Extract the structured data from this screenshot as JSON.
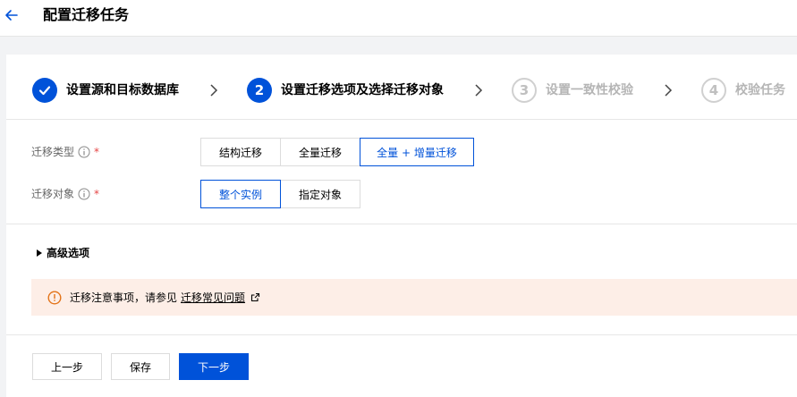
{
  "header": {
    "title": "配置迁移任务",
    "back_icon": "arrow-left-icon"
  },
  "steps": [
    {
      "number": "",
      "label": "设置源和目标数据库",
      "status": "done"
    },
    {
      "number": "2",
      "label": "设置迁移选项及选择迁移对象",
      "status": "active"
    },
    {
      "number": "3",
      "label": "设置一致性校验",
      "status": "wait"
    },
    {
      "number": "4",
      "label": "校验任务",
      "status": "wait"
    }
  ],
  "form": {
    "migration_type": {
      "label": "迁移类型",
      "options": [
        "结构迁移",
        "全量迁移",
        "全量 + 增量迁移"
      ],
      "selected": "全量 + 增量迁移"
    },
    "migration_object": {
      "label": "迁移对象",
      "options": [
        "整个实例",
        "指定对象"
      ],
      "selected": "整个实例"
    },
    "required_mark": "*"
  },
  "advanced": {
    "label": "高级选项"
  },
  "notice": {
    "text": "迁移注意事项，请参见",
    "link": "迁移常见问题"
  },
  "footer": {
    "prev_label": "上一步",
    "save_label": "保存",
    "next_label": "下一步"
  },
  "colors": {
    "primary": "#0052d9",
    "notice_bg": "#fdeee7",
    "warning": "#e37318",
    "required": "#e54545"
  }
}
